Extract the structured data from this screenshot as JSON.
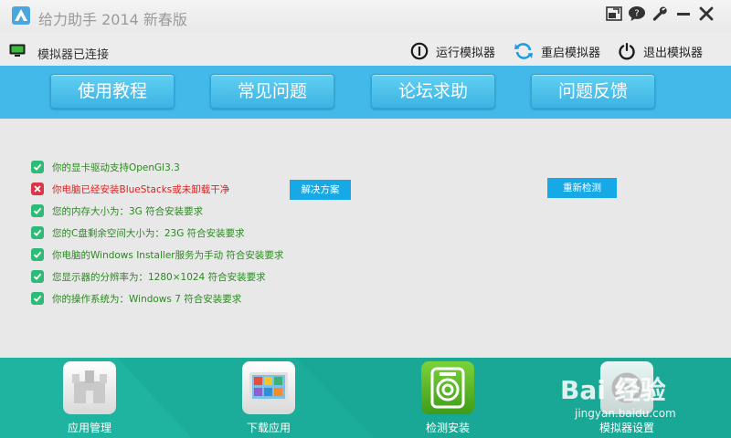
{
  "window": {
    "title": "给力助手 2014 新春版"
  },
  "status": {
    "text": "模拟器已连接"
  },
  "actions": {
    "run": "运行模拟器",
    "restart": "重启模拟器",
    "exit": "退出模拟器"
  },
  "nav": {
    "items": [
      "使用教程",
      "常见问题",
      "论坛求助",
      "问题反馈"
    ]
  },
  "checks": [
    {
      "text": "你的显卡驱动支持OpenGl3.3",
      "status": "ok"
    },
    {
      "text": "你电脑已经安装BlueStacks或未卸载干净",
      "status": "error"
    },
    {
      "text": "您的内存大小为：3G 符合安装要求",
      "status": "ok"
    },
    {
      "text": "您的C盘剩余空间大小为：23G 符合安装要求",
      "status": "ok"
    },
    {
      "text": "你电脑的Windows Installer服务为手动 符合安装要求",
      "status": "ok"
    },
    {
      "text": "您显示器的分辨率为：1280×1024 符合安装要求",
      "status": "ok"
    },
    {
      "text": "你的操作系统为：Windows 7 符合安装要求",
      "status": "ok"
    }
  ],
  "buttons": {
    "solution": "解决方案",
    "recheck": "重新检测"
  },
  "tools": [
    {
      "label": "应用管理",
      "icon": "app-manage-icon"
    },
    {
      "label": "下载应用",
      "icon": "download-app-icon"
    },
    {
      "label": "检测安装",
      "icon": "check-install-icon"
    },
    {
      "label": "模拟器设置",
      "icon": "emulator-settings-icon"
    }
  ],
  "watermark": {
    "text": "Bai 经验",
    "url": "jingyan.baidu.com"
  },
  "colors": {
    "accent_blue": "#42b9e8",
    "teal": "#1fb4a0",
    "ok_green": "#2a8a1f",
    "error_red": "#e02020"
  }
}
